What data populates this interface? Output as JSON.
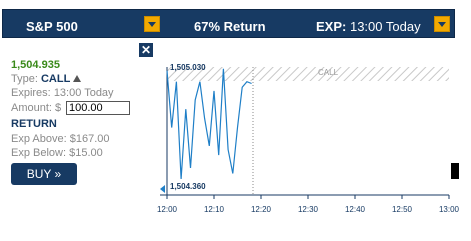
{
  "header": {
    "symbol": "S&P 500",
    "return_label": "67% Return",
    "expiry_prefix": "EXP:",
    "expiry_value": "13:00 Today"
  },
  "panel": {
    "close_glyph": "✕",
    "current_price": "1,504.935",
    "type_label": "Type:",
    "type_value": "CALL",
    "expires_label": "Expires:",
    "expires_value": "13:00 Today",
    "amount_label": "Amount: $",
    "amount_value": "100.00",
    "return_heading": "RETURN",
    "exp_above_label": "Exp Above:",
    "exp_above_value": "$167.00",
    "exp_below_label": "Exp Below:",
    "exp_below_value": "$15.00",
    "buy_label": "BUY »"
  },
  "chart_data": {
    "type": "line",
    "series": [
      {
        "x": [
          "12:00",
          "12:01",
          "12:02",
          "12:03",
          "12:04",
          "12:05",
          "12:06",
          "12:07",
          "12:08",
          "12:09",
          "12:10",
          "12:11",
          "12:12",
          "12:13",
          "12:14",
          "12:15",
          "12:16",
          "12:17",
          "12:18"
        ],
        "values": [
          1505.01,
          1504.7,
          1504.95,
          1504.42,
          1504.8,
          1504.48,
          1504.85,
          1504.95,
          1504.75,
          1504.6,
          1504.9,
          1504.55,
          1505.02,
          1504.58,
          1504.45,
          1504.7,
          1504.92,
          1504.95,
          1504.94
        ]
      }
    ],
    "high_label": "1,505.030",
    "low_label": "1,504.360",
    "ylim": [
      1504.36,
      1505.03
    ],
    "x_ticks": [
      "12:00",
      "12:10",
      "12:20",
      "12:30",
      "12:40",
      "12:50",
      "13:00"
    ],
    "zone_label": "CALL",
    "line_color": "#1f7fc7",
    "zone_color": "#bdbdbd"
  }
}
